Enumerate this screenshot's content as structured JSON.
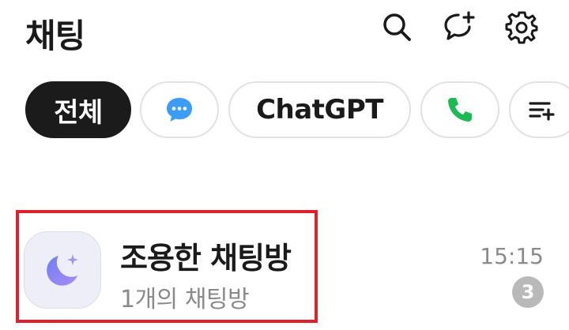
{
  "header": {
    "title": "채팅",
    "icons": [
      "search-icon",
      "new-chat-icon",
      "settings-icon"
    ]
  },
  "filters": {
    "chips": [
      {
        "label": "전체",
        "active": true
      },
      {
        "label": "",
        "icon": "messages-app-icon",
        "active": false
      },
      {
        "label": "ChatGPT",
        "active": false
      },
      {
        "label": "",
        "icon": "phone-icon",
        "active": false
      },
      {
        "label": "",
        "icon": "edit-filters-icon",
        "active": false
      }
    ]
  },
  "chat_list": [
    {
      "title": "조용한 채팅방",
      "subtitle": "1개의 채팅방",
      "time": "15:15",
      "unread": "3",
      "avatar_icon": "moon-icon"
    }
  ],
  "colors": {
    "active_chip_bg": "#1b1b1b",
    "highlight_border": "#e0202a",
    "badge_bg": "#b9b9b9",
    "phone_green": "#1db954",
    "messages_blue": "#3d9df5",
    "moon_purple": "#8b8ff0"
  }
}
